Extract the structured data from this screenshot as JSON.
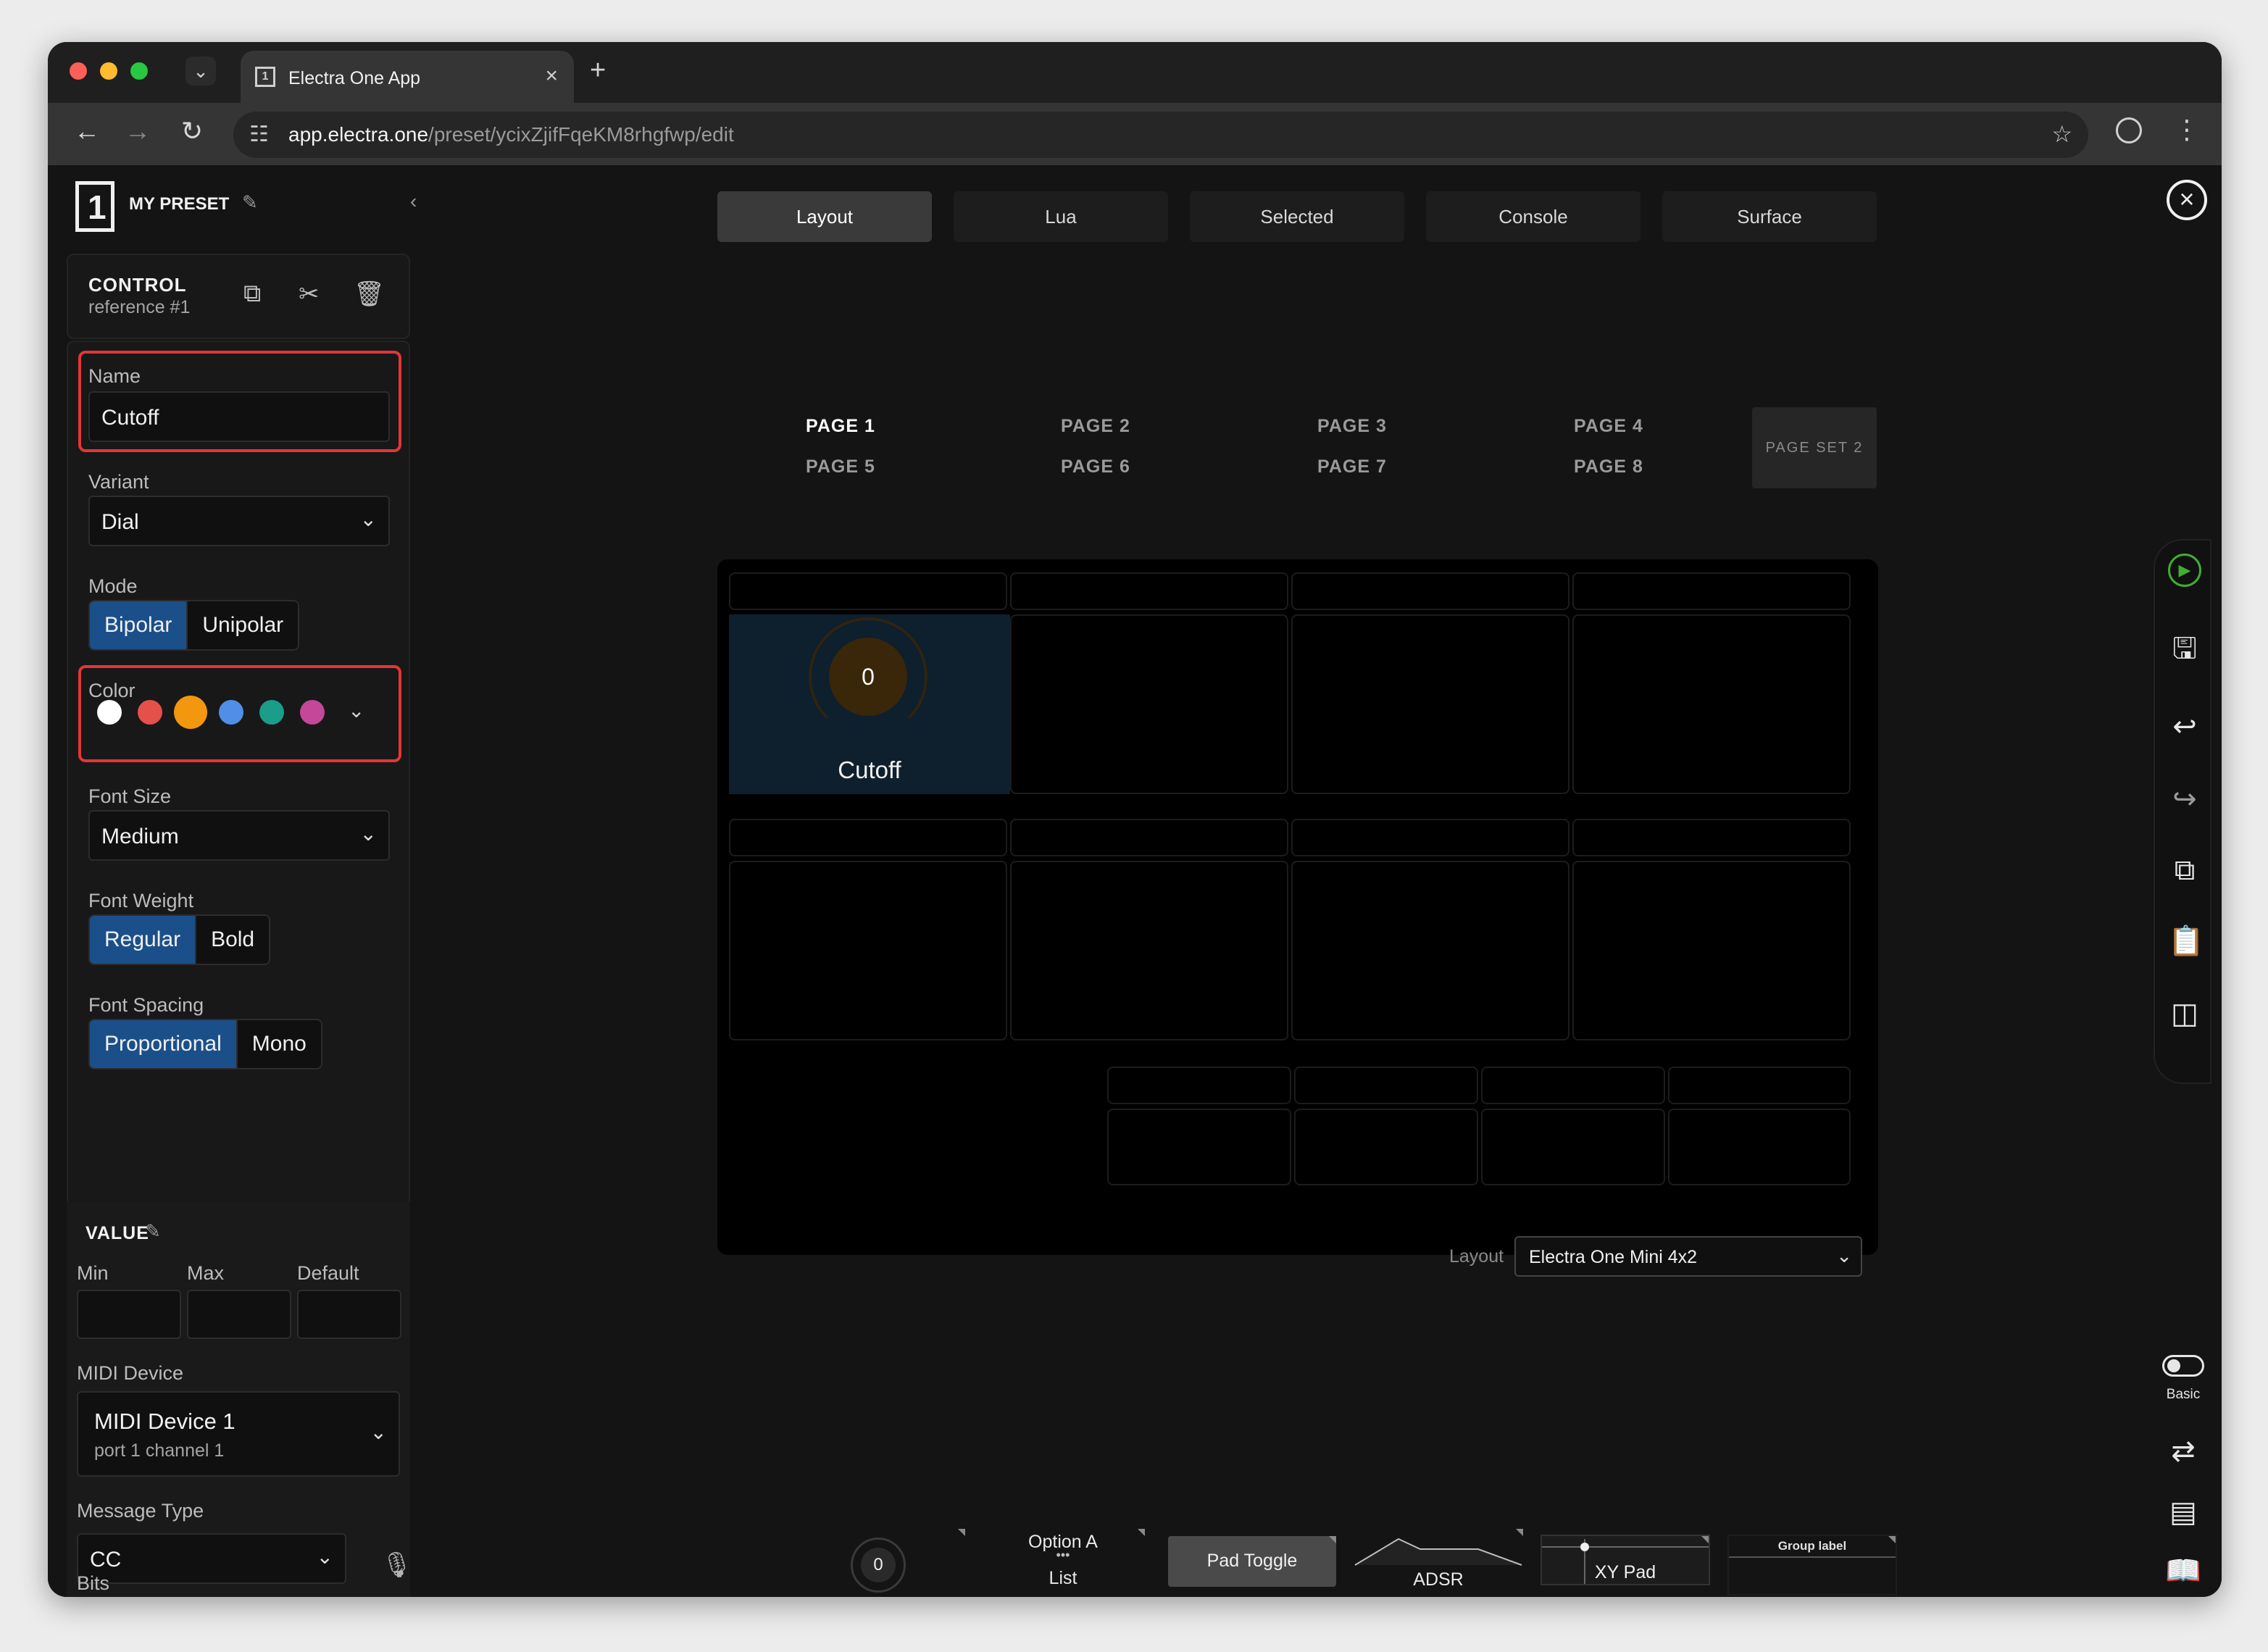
{
  "browser": {
    "tab_title": "Electra One App",
    "url_host": "app.electra.one",
    "url_path": "/preset/ycixZjifFqeKM8rhgfwp/edit"
  },
  "sidebar": {
    "preset_name": "MY PRESET",
    "control": {
      "title": "CONTROL",
      "subtitle": "reference #1"
    },
    "name_label": "Name",
    "name_value": "Cutoff",
    "variant_label": "Variant",
    "variant_value": "Dial",
    "mode_label": "Mode",
    "mode_options": [
      "Bipolar",
      "Unipolar"
    ],
    "color_label": "Color",
    "colors": [
      "#ffffff",
      "#e5504a",
      "#f2970e",
      "#4f8fe8",
      "#1a9d8a",
      "#c4479a"
    ],
    "selected_color": "#f2970e",
    "font_size_label": "Font Size",
    "font_size_value": "Medium",
    "font_weight_label": "Font Weight",
    "font_weight_options": [
      "Regular",
      "Bold"
    ],
    "font_spacing_label": "Font Spacing",
    "font_spacing_options": [
      "Proportional",
      "Mono"
    ],
    "value": {
      "title": "VALUE",
      "min_label": "Min",
      "max_label": "Max",
      "default_label": "Default",
      "midi_device_label": "MIDI Device",
      "midi_device_name": "MIDI Device 1",
      "midi_device_port": "port 1 channel 1",
      "message_type_label": "Message Type",
      "message_type_value": "CC",
      "bits_label": "Bits"
    }
  },
  "tabs": [
    "Layout",
    "Lua",
    "Selected",
    "Console",
    "Surface"
  ],
  "pages": {
    "row1": [
      "PAGE 1",
      "PAGE 2",
      "PAGE 3",
      "PAGE 4"
    ],
    "row2": [
      "PAGE 5",
      "PAGE 6",
      "PAGE 7",
      "PAGE 8"
    ],
    "page_set": "PAGE SET 2"
  },
  "device": {
    "control_value": "0",
    "control_name": "Cutoff",
    "control_color": "#f2970e"
  },
  "layout": {
    "label": "Layout",
    "value": "Electra One Mini 4x2"
  },
  "palette": {
    "knob_value": "0",
    "list_option": "Option A",
    "list_label": "List",
    "pad_toggle": "Pad Toggle",
    "adsr": "ADSR",
    "xy_pad": "XY Pad",
    "group_label": "Group label"
  },
  "rail": {
    "basic_label": "Basic"
  }
}
